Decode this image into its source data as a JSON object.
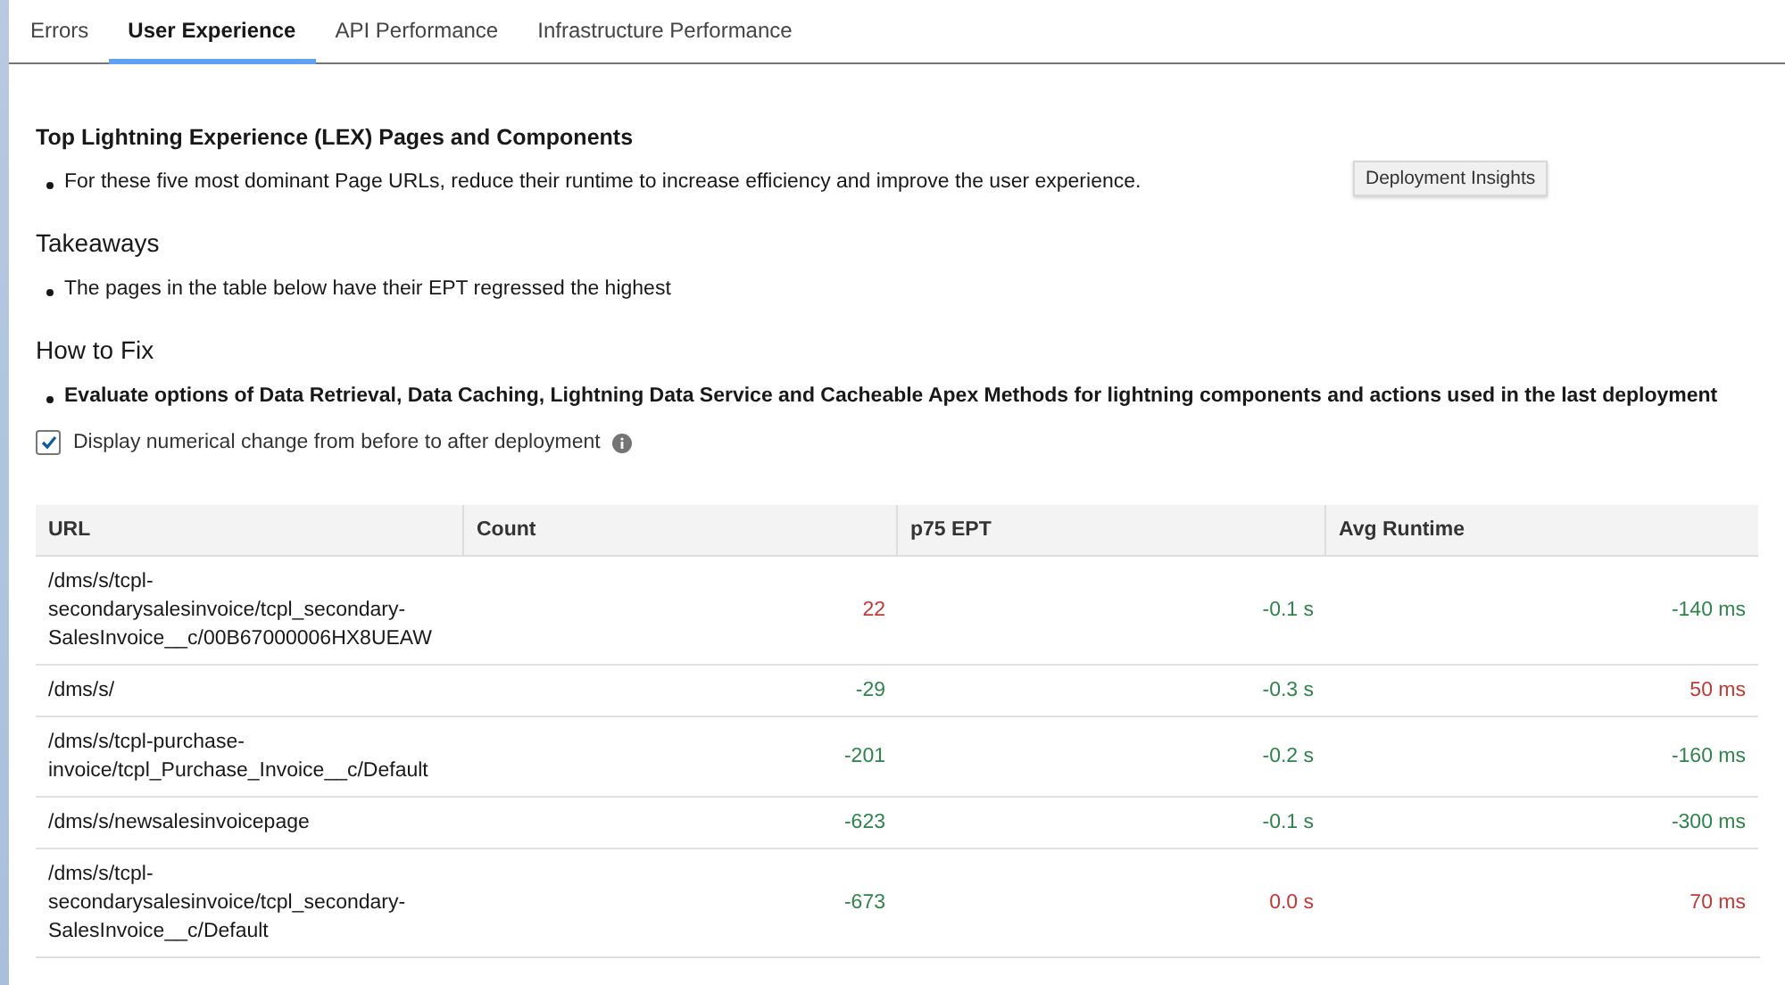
{
  "tabs": [
    {
      "label": "Errors",
      "selected": false
    },
    {
      "label": "User Experience",
      "selected": true
    },
    {
      "label": "API Performance",
      "selected": false
    },
    {
      "label": "Infrastructure Performance",
      "selected": false
    }
  ],
  "heading": "Top Lightning Experience (LEX) Pages and Components",
  "intro_bullets": [
    "For these five most dominant Page URLs, reduce their runtime to increase efficiency and improve the user experience."
  ],
  "tooltip": "Deployment Insights",
  "takeaways": {
    "title": "Takeaways",
    "bullets": [
      "The pages in the table below have their EPT regressed the highest"
    ]
  },
  "how_to_fix": {
    "title": "How to Fix",
    "bullets": [
      "Evaluate options of Data Retrieval, Data Caching, Lightning Data Service and Cacheable Apex Methods for lightning components and actions used in the last deployment"
    ]
  },
  "option": {
    "label": "Display numerical change from before to after deployment",
    "checked": true
  },
  "table": {
    "columns": [
      "URL",
      "Count",
      "p75 EPT",
      "Avg Runtime"
    ],
    "rows": [
      {
        "url": "/dms/s/tcpl-secondarysalesinvoice/tcpl_secondary-SalesInvoice__c/00B67000006HX8UEAW",
        "cells": [
          {
            "text": "22",
            "color": "#c23934"
          },
          {
            "text": "-0.1 s",
            "color": "#2e844a"
          },
          {
            "text": "-140 ms",
            "color": "#2e844a"
          }
        ]
      },
      {
        "url": "/dms/s/",
        "cells": [
          {
            "text": "-29",
            "color": "#2e844a"
          },
          {
            "text": "-0.3 s",
            "color": "#2e844a"
          },
          {
            "text": "50 ms",
            "color": "#c23934"
          }
        ]
      },
      {
        "url": "/dms/s/tcpl-purchase-invoice/tcpl_Purchase_Invoice__c/Default",
        "cells": [
          {
            "text": "-201",
            "color": "#2e844a"
          },
          {
            "text": "-0.2 s",
            "color": "#2e844a"
          },
          {
            "text": "-160 ms",
            "color": "#2e844a"
          }
        ]
      },
      {
        "url": "/dms/s/newsalesinvoicepage",
        "cells": [
          {
            "text": "-623",
            "color": "#2e844a"
          },
          {
            "text": "-0.1 s",
            "color": "#2e844a"
          },
          {
            "text": "-300 ms",
            "color": "#2e844a"
          }
        ]
      },
      {
        "url": "/dms/s/tcpl-secondarysalesinvoice/tcpl_secondary-SalesInvoice__c/Default",
        "cells": [
          {
            "text": "-673",
            "color": "#2e844a"
          },
          {
            "text": "0.0 s",
            "color": "#c23934"
          },
          {
            "text": "70 ms",
            "color": "#c23934"
          }
        ]
      }
    ]
  }
}
